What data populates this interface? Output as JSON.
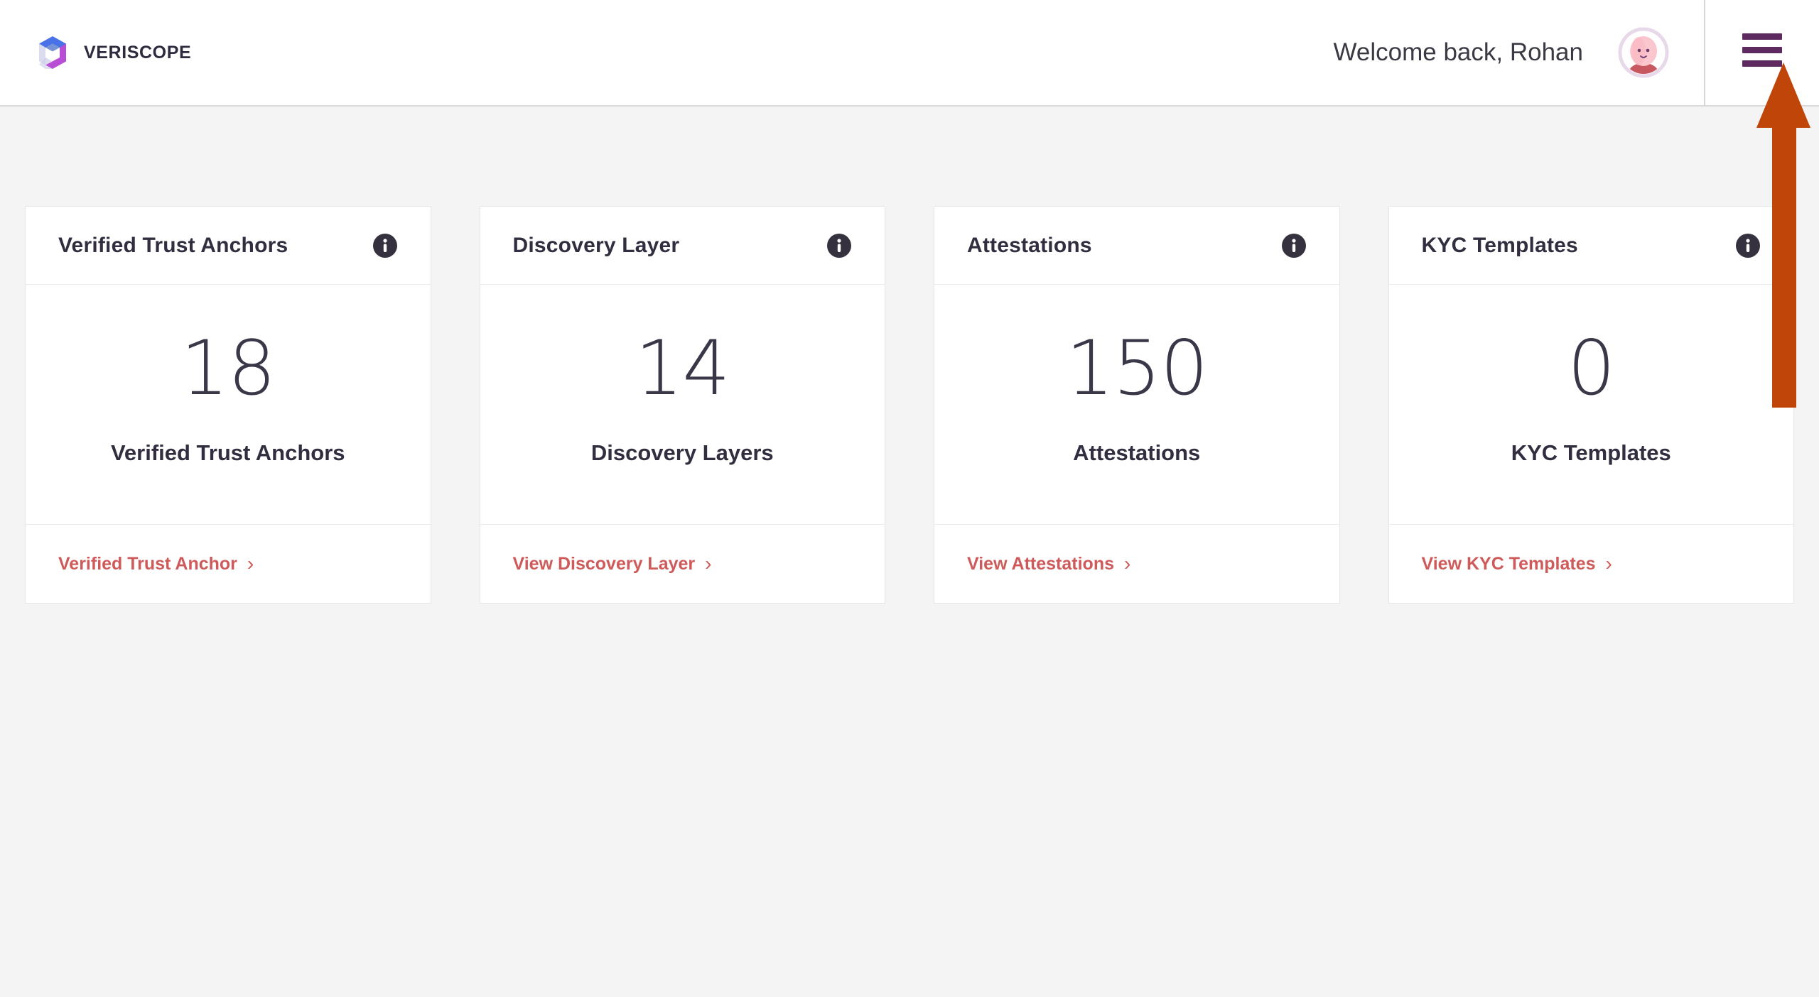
{
  "header": {
    "brand_name": "VERISCOPE",
    "brand_logo_icon": "veriscope-spiral-logo",
    "welcome_message": "Welcome back, Rohan",
    "avatar_icon": "user-avatar",
    "menu_icon": "hamburger-menu-icon",
    "menu_color": "#5C2A5E"
  },
  "annotation": {
    "type": "arrow",
    "direction": "up",
    "target": "hamburger-menu-icon",
    "color": "#BF4508"
  },
  "theme": {
    "background": "#F4F4F4",
    "card_background": "#FFFFFF",
    "text_dark": "#322E40",
    "link_red": "#CF5A5A",
    "border": "#E6E6E6"
  },
  "cards": [
    {
      "title": "Verified Trust Anchors",
      "info_icon": "info-icon",
      "value": "18",
      "label": "Verified Trust Anchors",
      "link_label": "Verified Trust Anchor",
      "chevron": "›"
    },
    {
      "title": "Discovery Layer",
      "info_icon": "info-icon",
      "value": "14",
      "label": "Discovery Layers",
      "link_label": "View Discovery Layer",
      "chevron": "›"
    },
    {
      "title": "Attestations",
      "info_icon": "info-icon",
      "value": "150",
      "label": "Attestations",
      "link_label": "View Attestations",
      "chevron": "›"
    },
    {
      "title": "KYC Templates",
      "info_icon": "info-icon",
      "value": "0",
      "label": "KYC Templates",
      "link_label": "View KYC Templates",
      "chevron": "›"
    }
  ]
}
